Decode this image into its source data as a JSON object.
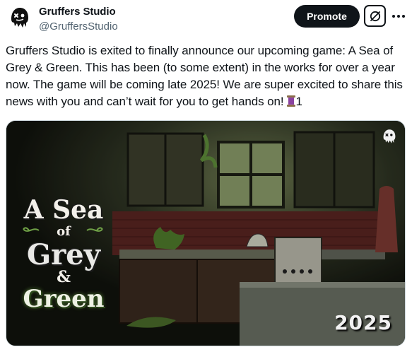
{
  "author": {
    "name": "Gruffers Studio",
    "handle": "@GruffersStudio",
    "avatar_icon": "skull-drip-icon"
  },
  "actions": {
    "promote_label": "Promote",
    "grok_icon": "grok-icon",
    "more_icon": "more-dots-icon"
  },
  "post": {
    "text": "Gruffers Studio is exited to finally announce our upcoming game: A Sea of Grey & Green. This has been (to some extent) in the works for over a year now. The game will be coming late 2025! We are super excited to share this news with you and can’t wait for you to get hands on!",
    "emoji_icon": "thread-spool-emoji",
    "trailing_text": "1"
  },
  "media": {
    "title_line1": "A Sea",
    "title_line2": "of",
    "title_line3": "Grey",
    "title_line4": "&",
    "title_line5": "Green",
    "year": "2025",
    "corner_logo_icon": "skull-drip-icon"
  },
  "colors": {
    "promote_bg": "#0f1419",
    "text_primary": "#0f1419",
    "text_secondary": "#536471"
  }
}
